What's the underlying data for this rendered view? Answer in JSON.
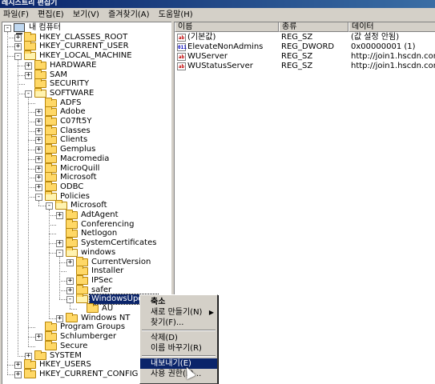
{
  "window": {
    "title": "레지스트리 편집기"
  },
  "menu": [
    "파일(F)",
    "편집(E)",
    "보기(V)",
    "즐겨찾기(A)",
    "도움말(H)"
  ],
  "tree": [
    {
      "label": "내 컴퓨터",
      "level": 0,
      "kind": "computer",
      "expander": "-"
    },
    {
      "label": "HKEY_CLASSES_ROOT",
      "level": 1,
      "expander": "+"
    },
    {
      "label": "HKEY_CURRENT_USER",
      "level": 1,
      "expander": "+"
    },
    {
      "label": "HKEY_LOCAL_MACHINE",
      "level": 1,
      "expander": "-",
      "open": true
    },
    {
      "label": "HARDWARE",
      "level": 2,
      "expander": "+"
    },
    {
      "label": "SAM",
      "level": 2,
      "expander": "+"
    },
    {
      "label": "SECURITY",
      "level": 2,
      "expander": ""
    },
    {
      "label": "SOFTWARE",
      "level": 2,
      "expander": "-",
      "open": true
    },
    {
      "label": "ADFS",
      "level": 3,
      "expander": ""
    },
    {
      "label": "Adobe",
      "level": 3,
      "expander": "+"
    },
    {
      "label": "C07ft5Y",
      "level": 3,
      "expander": "+"
    },
    {
      "label": "Classes",
      "level": 3,
      "expander": "+"
    },
    {
      "label": "Clients",
      "level": 3,
      "expander": "+"
    },
    {
      "label": "Gemplus",
      "level": 3,
      "expander": "+"
    },
    {
      "label": "Macromedia",
      "level": 3,
      "expander": "+"
    },
    {
      "label": "MicroQuill",
      "level": 3,
      "expander": "+"
    },
    {
      "label": "Microsoft",
      "level": 3,
      "expander": "+"
    },
    {
      "label": "ODBC",
      "level": 3,
      "expander": "+"
    },
    {
      "label": "Policies",
      "level": 3,
      "expander": "-",
      "open": true
    },
    {
      "label": "Microsoft",
      "level": 4,
      "expander": "-",
      "open": true
    },
    {
      "label": "AdtAgent",
      "level": 5,
      "expander": "+"
    },
    {
      "label": "Conferencing",
      "level": 5,
      "expander": ""
    },
    {
      "label": "Netlogon",
      "level": 5,
      "expander": ""
    },
    {
      "label": "SystemCertificates",
      "level": 5,
      "expander": "+"
    },
    {
      "label": "windows",
      "level": 5,
      "expander": "-",
      "open": true
    },
    {
      "label": "CurrentVersion",
      "level": 6,
      "expander": "+"
    },
    {
      "label": "Installer",
      "level": 6,
      "expander": ""
    },
    {
      "label": "IPSec",
      "level": 6,
      "expander": "+"
    },
    {
      "label": "safer",
      "level": 6,
      "expander": "+"
    },
    {
      "label": "WindowsUpdate",
      "level": 6,
      "expander": "-",
      "open": true,
      "selected": true
    },
    {
      "label": "AU",
      "level": 7,
      "expander": ""
    },
    {
      "label": "Windows NT",
      "level": 5,
      "expander": "+"
    },
    {
      "label": "Program Groups",
      "level": 3,
      "expander": ""
    },
    {
      "label": "Schlumberger",
      "level": 3,
      "expander": "+"
    },
    {
      "label": "Secure",
      "level": 3,
      "expander": ""
    },
    {
      "label": "SYSTEM",
      "level": 2,
      "expander": "+"
    },
    {
      "label": "HKEY_USERS",
      "level": 1,
      "expander": "+"
    },
    {
      "label": "HKEY_CURRENT_CONFIG",
      "level": 1,
      "expander": "+"
    }
  ],
  "list": {
    "columns": [
      "이름",
      "종류",
      "데이터"
    ],
    "rows": [
      {
        "icon": "ab",
        "name": "(기본값)",
        "type": "REG_SZ",
        "data": "(값 설정 안됨)"
      },
      {
        "icon": "dw",
        "name": "ElevateNonAdmins",
        "type": "REG_DWORD",
        "data": "0x00000001 (1)"
      },
      {
        "icon": "ab",
        "name": "WUServer",
        "type": "REG_SZ",
        "data": "http://join1.hscdn.com"
      },
      {
        "icon": "ab",
        "name": "WUStatusServer",
        "type": "REG_SZ",
        "data": "http://join1.hscdn.com"
      }
    ]
  },
  "context_menu": {
    "items": [
      {
        "label": "축소",
        "bold": true
      },
      {
        "label": "새로 만들기(N)",
        "submenu": true
      },
      {
        "label": "찾기(F)..."
      },
      {
        "sep": true
      },
      {
        "label": "삭제(D)"
      },
      {
        "label": "이름 바꾸기(R)"
      },
      {
        "sep": true
      },
      {
        "label": "내보내기(E)",
        "highlight": true
      },
      {
        "label": "사용 권한(P)..."
      }
    ],
    "submenu_arrow": "▶"
  },
  "icons": {
    "string_value": "ab",
    "dword_value": "011"
  }
}
